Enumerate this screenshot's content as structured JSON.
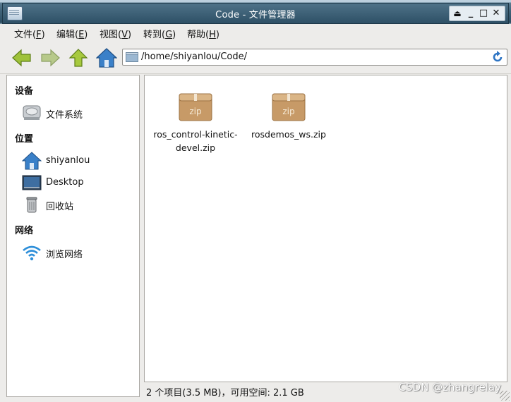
{
  "window": {
    "title": "Code - 文件管理器",
    "controls": {
      "eject": "⏏",
      "minimize": "_",
      "maximize": "□",
      "close": "✕"
    }
  },
  "menubar": [
    {
      "label": "文件(",
      "key": "F",
      "end": ")"
    },
    {
      "label": "编辑(",
      "key": "E",
      "end": ")"
    },
    {
      "label": "视图(",
      "key": "V",
      "end": ")"
    },
    {
      "label": "转到(",
      "key": "G",
      "end": ")"
    },
    {
      "label": "帮助(",
      "key": "H",
      "end": ")"
    }
  ],
  "toolbar": {
    "back_icon": "arrow-left-icon",
    "forward_icon": "arrow-right-icon",
    "up_icon": "arrow-up-icon",
    "home_icon": "home-icon",
    "address": "/home/shiyanlou/Code/",
    "reload_icon": "reload-icon"
  },
  "sidebar": {
    "devices_heading": "设备",
    "devices": [
      {
        "label": "文件系统",
        "icon": "harddisk-icon"
      }
    ],
    "places_heading": "位置",
    "places": [
      {
        "label": "shiyanlou",
        "icon": "home-icon"
      },
      {
        "label": "Desktop",
        "icon": "desktop-icon"
      },
      {
        "label": "回收站",
        "icon": "trash-icon"
      }
    ],
    "network_heading": "网络",
    "network": [
      {
        "label": "浏览网络",
        "icon": "wifi-icon"
      }
    ]
  },
  "files": [
    {
      "name_line1": "ros_control-kinetic-",
      "name_line2": "devel.zip",
      "icon_label": "zip"
    },
    {
      "name_line1": "rosdemos_ws.zip",
      "name_line2": "",
      "icon_label": "zip"
    }
  ],
  "status": {
    "text": "2 个项目(3.5 MB)，可用空间: 2.1 GB",
    "watermark": "CSDN @zhangrelay"
  },
  "colors": {
    "titlebar": "#3f6278",
    "zip_box": "#c79a67",
    "nav_arrow": "#9fc23a",
    "home_roof": "#3a80c8"
  }
}
